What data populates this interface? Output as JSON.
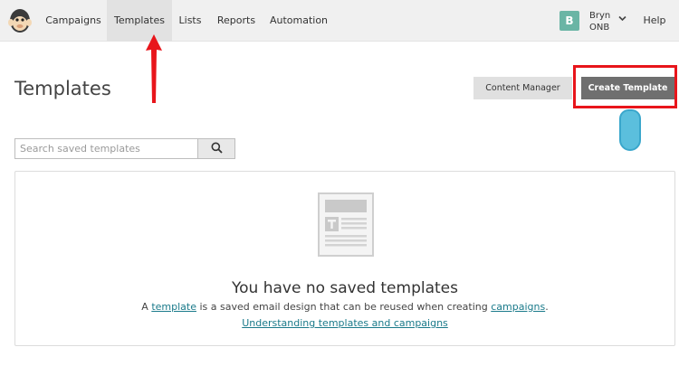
{
  "nav": {
    "items": [
      {
        "label": "Campaigns"
      },
      {
        "label": "Templates"
      },
      {
        "label": "Lists"
      },
      {
        "label": "Reports"
      },
      {
        "label": "Automation"
      }
    ],
    "active_index": 1,
    "user": {
      "avatar_letter": "B",
      "name": "Bryn",
      "org": "ONB"
    },
    "help_label": "Help"
  },
  "page": {
    "title": "Templates",
    "content_manager_label": "Content Manager",
    "create_template_label": "Create Template"
  },
  "search": {
    "placeholder": "Search saved templates",
    "value": ""
  },
  "empty_state": {
    "title": "You have no saved templates",
    "desc_prefix": "A ",
    "desc_link1": "template",
    "desc_middle": " is a saved email design that can be reused when creating ",
    "desc_link2": "campaigns",
    "desc_suffix": ".",
    "link_text": "Understanding templates and campaigns"
  },
  "colors": {
    "topbar_bg": "#f0f0f0",
    "active_nav_bg": "#e2e2e2",
    "avatar_bg": "#6ab5a5",
    "create_button_bg": "#6f6f6f",
    "annotation_red": "#e8151b",
    "cursor_blue": "#5bbfdd",
    "link_color": "#1a7a8a"
  },
  "icons": [
    "mailchimp-logo-icon",
    "chevron-down-icon",
    "search-icon",
    "template-document-icon"
  ]
}
